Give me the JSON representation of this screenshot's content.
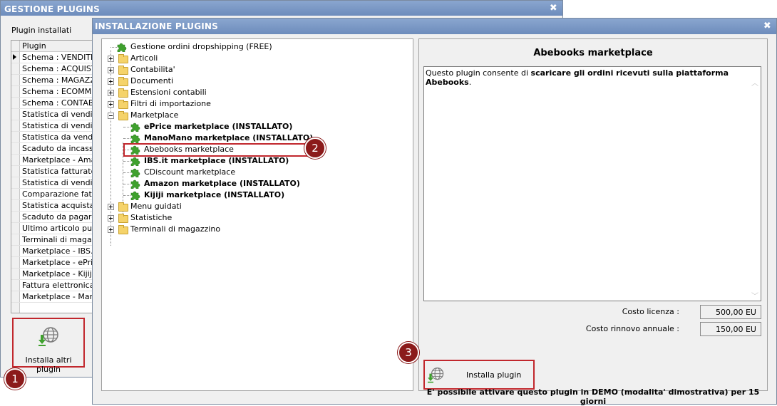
{
  "back_window": {
    "title": "GESTIONE PLUGINS",
    "close": "✖",
    "subtitle": "Plugin installati",
    "grid_header": "Plugin",
    "rows": [
      "Schema : VENDITE",
      "Schema : ACQUISTI",
      "Schema : MAGAZZIN",
      "Schema : ECOMMERC",
      "Schema : CONTABILI",
      "Statistica di vendita p",
      "Statistica di vendita p",
      "Statistica da vendita p",
      "Scaduto da incassare",
      "Marketplace - Amazo",
      "Statistica fatturato m",
      "Statistica di vendita p",
      "Comparazione fattur",
      "Statistica acquistato",
      "Scaduto da pagare a",
      "Ultimo articolo pubbli",
      "Terminali di magazzin",
      "Marketplace - IBS.it",
      "Marketplace - ePrice",
      "Marketplace - Kijiji",
      "Fattura elettronica",
      "Marketplace - ManoM",
      ""
    ],
    "install_other_label": "Installa altri plugin",
    "badge": "1"
  },
  "front_window": {
    "title": "INSTALLAZIONE PLUGINS",
    "close": "✖",
    "tree": {
      "dropshipping": "Gestione ordini dropshipping (FREE)",
      "articoli": "Articoli",
      "contabilita": "Contabilita'",
      "documenti": "Documenti",
      "estensioni": "Estensioni contabili",
      "filtri": "Filtri di importazione",
      "marketplace": "Marketplace",
      "eprice": "ePrice marketplace (INSTALLATO)",
      "manomano": "ManoMano marketplace (INSTALLATO)",
      "abebooks": "Abebooks marketplace",
      "ibs": "IBS.it marketplace (INSTALLATO)",
      "cdiscount": "CDiscount marketplace",
      "amazon": "Amazon marketplace (INSTALLATO)",
      "kijiji": "Kijiji marketplace (INSTALLATO)",
      "menu": "Menu guidati",
      "statistiche": "Statistiche",
      "terminali": "Terminali di magazzino"
    },
    "badge_tree": "2",
    "detail": {
      "title": "Abebooks marketplace",
      "desc_prefix": "Questo plugin consente di ",
      "desc_bold": "scaricare gli ordini ricevuti sulla piattaforma Abebooks",
      "desc_suffix": ".",
      "license_label": "Costo licenza :",
      "license_value": "500,00 EU",
      "renewal_label": "Costo rinnovo annuale :",
      "renewal_value": "150,00 EU",
      "install_label": "Installa plugin",
      "badge_install": "3",
      "demo_note": "E' possibile attivare questo plugin in DEMO (modalita' dimostrativa) per 15 giorni"
    }
  },
  "colors": {
    "title_gradient_top": "#8aa6cf",
    "title_gradient_bottom": "#6d8cbc",
    "highlight": "#c1272d",
    "badge": "#8b1a1a",
    "plugin_green": "#3fa12e"
  },
  "icons": {
    "install": "globe-download-icon",
    "plugin": "puzzle-piece-icon",
    "folder": "folder-icon"
  }
}
